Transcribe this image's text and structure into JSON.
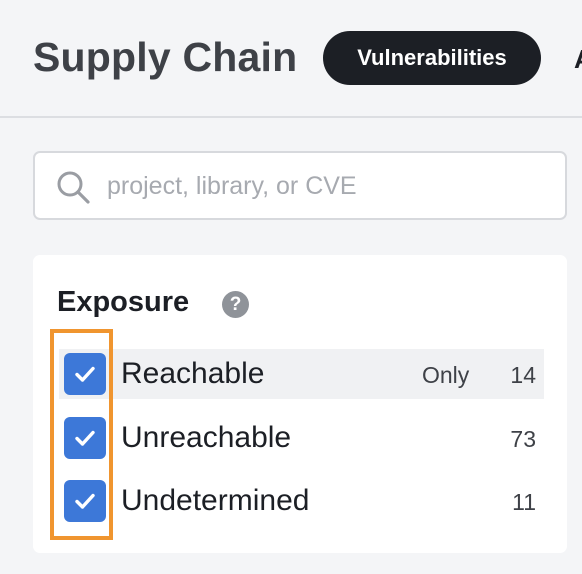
{
  "header": {
    "title": "Supply Chain",
    "tabs": [
      {
        "label": "Vulnerabilities",
        "active": true
      },
      {
        "label": "A",
        "active": false
      }
    ]
  },
  "search": {
    "placeholder": "project, library, or CVE",
    "value": ""
  },
  "exposure": {
    "title": "Exposure",
    "help": "?",
    "options": [
      {
        "label": "Reachable",
        "checked": true,
        "only": "Only",
        "count": "14"
      },
      {
        "label": "Unreachable",
        "checked": true,
        "count": "73"
      },
      {
        "label": "Undetermined",
        "checked": true,
        "count": "11"
      }
    ]
  },
  "colors": {
    "accent": "#3d78d8",
    "highlight": "#f0952f",
    "tab_active_bg": "#1c1f25"
  }
}
